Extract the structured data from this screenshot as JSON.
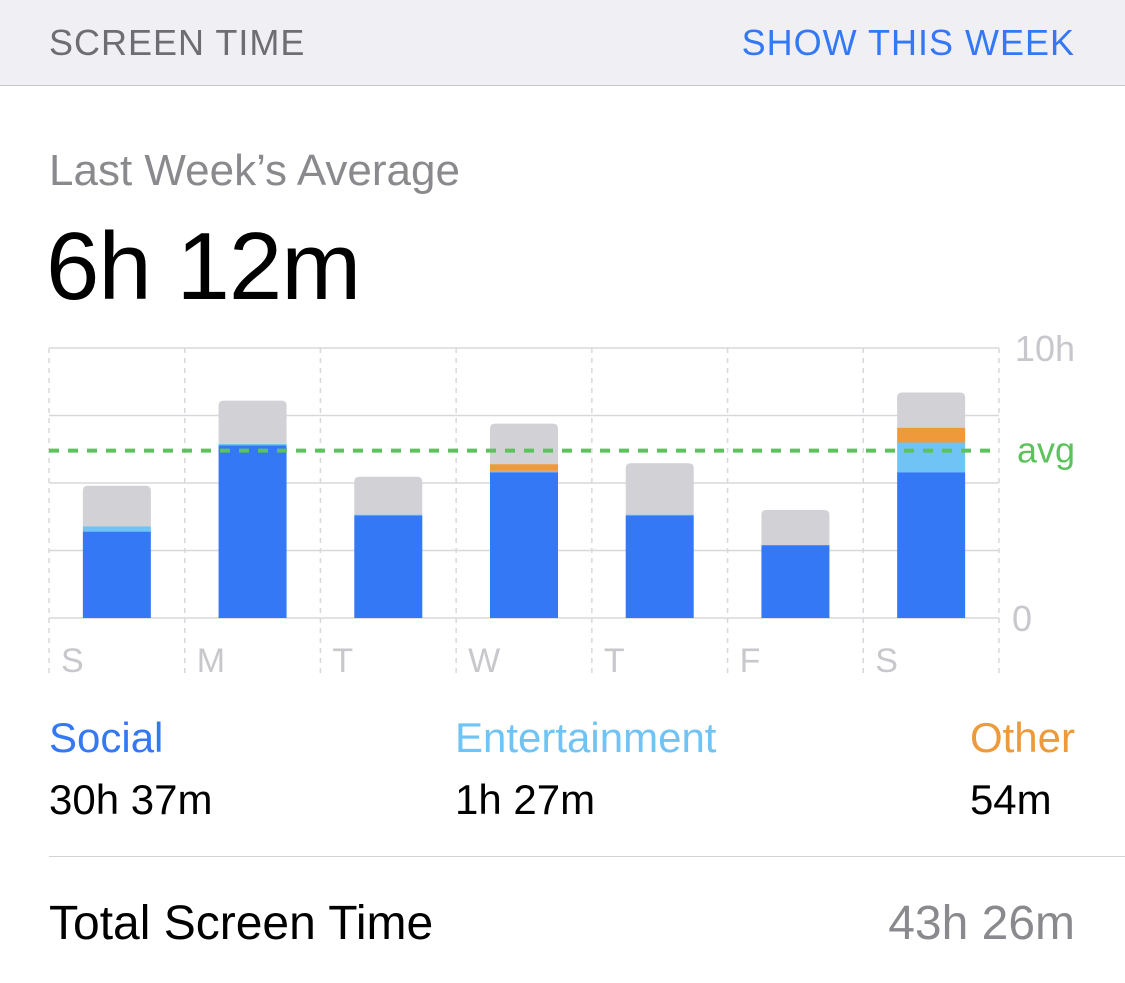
{
  "header": {
    "title": "SCREEN TIME",
    "action_label": "SHOW THIS WEEK"
  },
  "summary": {
    "label": "Last Week’s Average",
    "value": "6h 12m"
  },
  "chart_data": {
    "type": "bar",
    "stacked": true,
    "categories": [
      "S",
      "M",
      "T",
      "W",
      "T",
      "F",
      "S"
    ],
    "series": [
      {
        "name": "Social",
        "color": "#3478f6",
        "values": [
          3.2,
          6.4,
          3.8,
          5.4,
          3.8,
          2.7,
          5.4
        ]
      },
      {
        "name": "Entertainment",
        "color": "#6fc3f5",
        "values": [
          0.2,
          0.05,
          0.03,
          0.05,
          0.03,
          0.0,
          1.1
        ]
      },
      {
        "name": "Other",
        "color": "#ee9a3a",
        "values": [
          0.0,
          0.0,
          0.0,
          0.25,
          0.0,
          0.0,
          0.55
        ]
      },
      {
        "color": "#d1d1d6",
        "values": [
          1.5,
          1.6,
          1.4,
          1.5,
          1.9,
          1.3,
          1.3
        ]
      }
    ],
    "average": 6.2,
    "average_label": "avg",
    "ylim": [
      0,
      10
    ],
    "y_tick_labels": [
      "10h",
      "0"
    ],
    "gridlines": true
  },
  "legend": [
    {
      "name": "Social",
      "value": "30h 37m",
      "color": "#3478f6"
    },
    {
      "name": "Entertainment",
      "value": "1h 27m",
      "color": "#6fc3f5"
    },
    {
      "name": "Other",
      "value": "54m",
      "color": "#ee9a3a"
    }
  ],
  "total": {
    "label": "Total Screen Time",
    "value": "43h 26m"
  }
}
